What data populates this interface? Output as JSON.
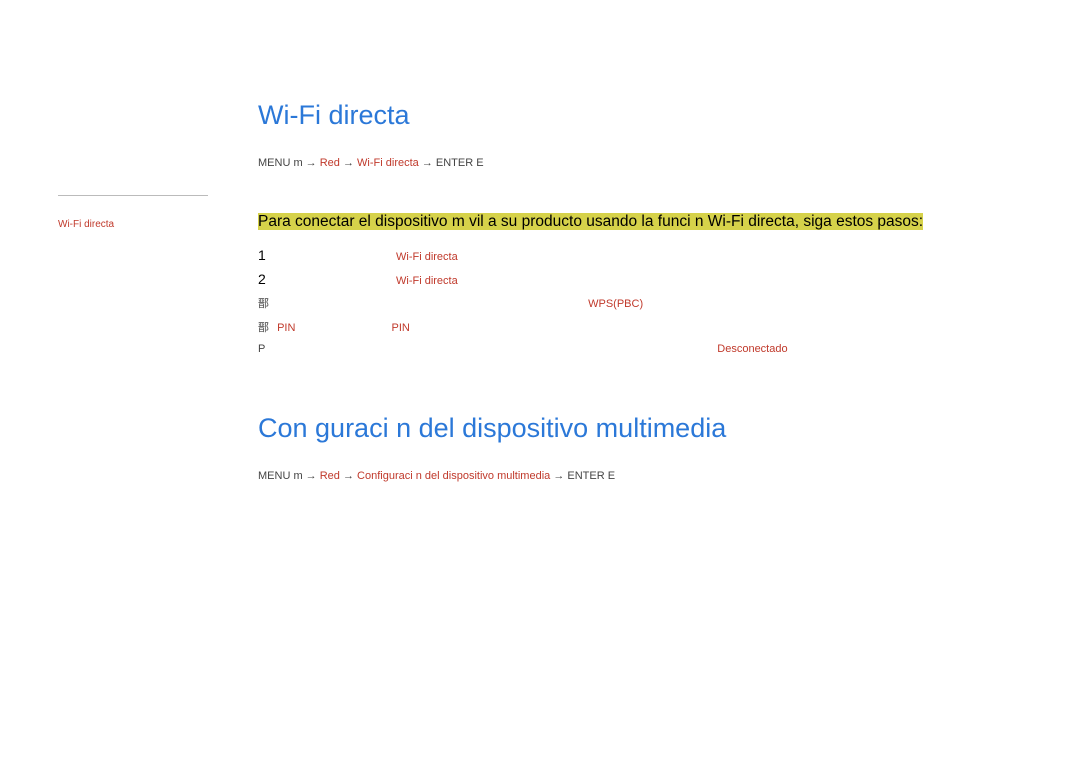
{
  "sidebar": {
    "items": [
      {
        "label": "Wi-Fi directa"
      }
    ]
  },
  "section1": {
    "title": "Wi-Fi directa",
    "bc_prefix": "MENU m → ",
    "bc_red1": "Red",
    "bc_arrow1": " → ",
    "bc_red2": "Wi-Fi directa",
    "bc_arrow2": " → ",
    "bc_suffix": "ENTER E",
    "intro": "Para conectar el dispositivo m vil a su producto usando la funci n Wi-Fi directa, siga estos pasos:",
    "step1_num": "1",
    "step1_red": "Wi-Fi directa",
    "step2_num": "2",
    "step2_red": "Wi-Fi directa",
    "bullet1_glyph": "鄑",
    "bullet1_red": "WPS(PBC)",
    "bullet2_glyph": "鄑",
    "bullet2_red1": "PIN",
    "bullet2_red2": "PIN",
    "note_prefix": "P",
    "note_red": "Desconectado"
  },
  "section2": {
    "title": "Con guraci n del dispositivo multimedia",
    "bc_prefix": "MENU m → ",
    "bc_red1": "Red",
    "bc_arrow1": " → ",
    "bc_red2": "Configuraci n del dispositivo multimedia",
    "bc_arrow2": " → ",
    "bc_suffix": "ENTER E"
  }
}
